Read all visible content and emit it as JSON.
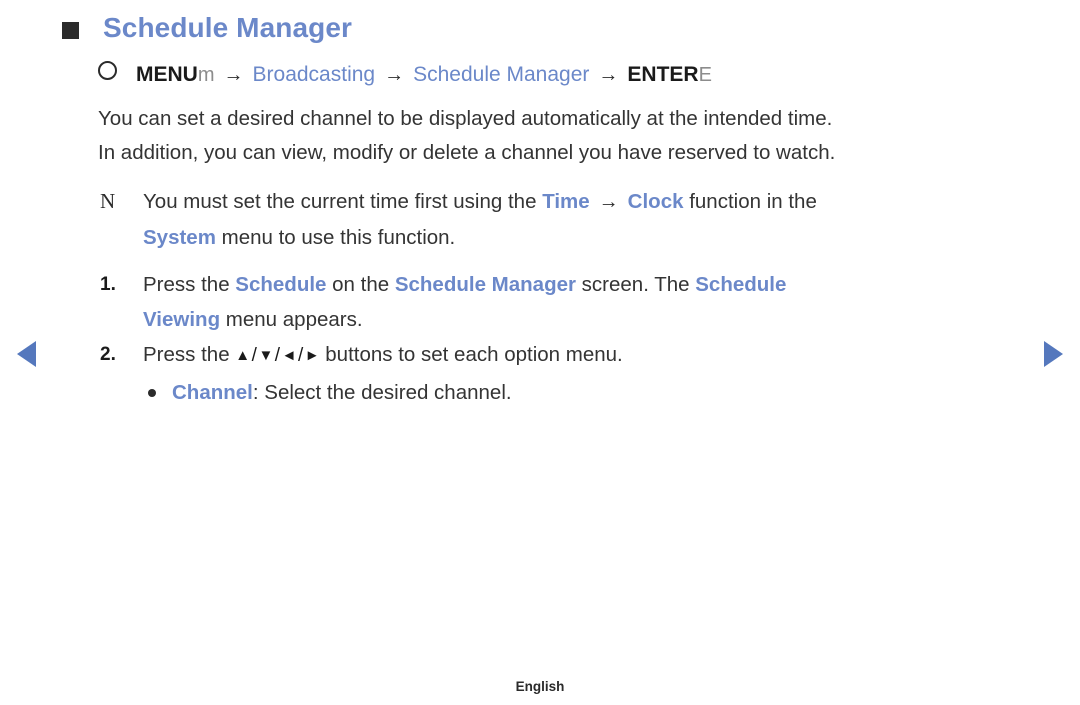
{
  "page": {
    "heading": "Schedule Manager",
    "heading_color": "#6b88c9",
    "bullet_icon": "square-bullet-icon",
    "footer_language": "English"
  },
  "menu_path": {
    "circle_icon": "circle-outline-icon",
    "menu_key": "MENU",
    "menu_key_symbol": "m",
    "arrow1": "→",
    "item1": "Broadcasting",
    "arrow2": "→",
    "item2": "Schedule Manager",
    "arrow3": "→",
    "enter_key": "ENTER",
    "enter_key_symbol": "E"
  },
  "description": {
    "line1": "You can set a desired channel to be displayed automatically at the intended time.",
    "line2": "In addition, you can view, modify or delete a channel you have reserved to watch."
  },
  "note": {
    "glyph": "N",
    "glyph_icon": "note-marker-icon",
    "text_a": "You must set the current time first using the ",
    "key_time": "Time",
    "arrow": "→",
    "key_clock": "Clock",
    "text_b": " function in the",
    "key_system": "System",
    "text_c": " menu to use this function."
  },
  "steps": [
    {
      "number": "1.",
      "line1_a": "Press the ",
      "line1_key1": "Schedule",
      "line1_b": " on the ",
      "line1_key2": "Schedule Manager",
      "line1_c": " screen. The ",
      "line1_key3": "Schedule",
      "line2_key": "Viewing",
      "line2_b": " menu appears."
    },
    {
      "number": "2.",
      "text_a": "Press the ",
      "btn_up": "▲",
      "sep1": "/",
      "btn_down": "▼",
      "sep2": "/",
      "btn_left": "◄",
      "sep3": "/",
      "btn_right": "►",
      "text_b": " buttons to set each option menu."
    }
  ],
  "sub_items": [
    {
      "bullet_icon": "round-bullet-icon",
      "label": "Channel",
      "text": ": Select the desired channel."
    }
  ],
  "navigation": {
    "prev_icon": "triangle-left-icon",
    "next_icon": "triangle-right-icon",
    "arrow_color": "#5578bd"
  }
}
